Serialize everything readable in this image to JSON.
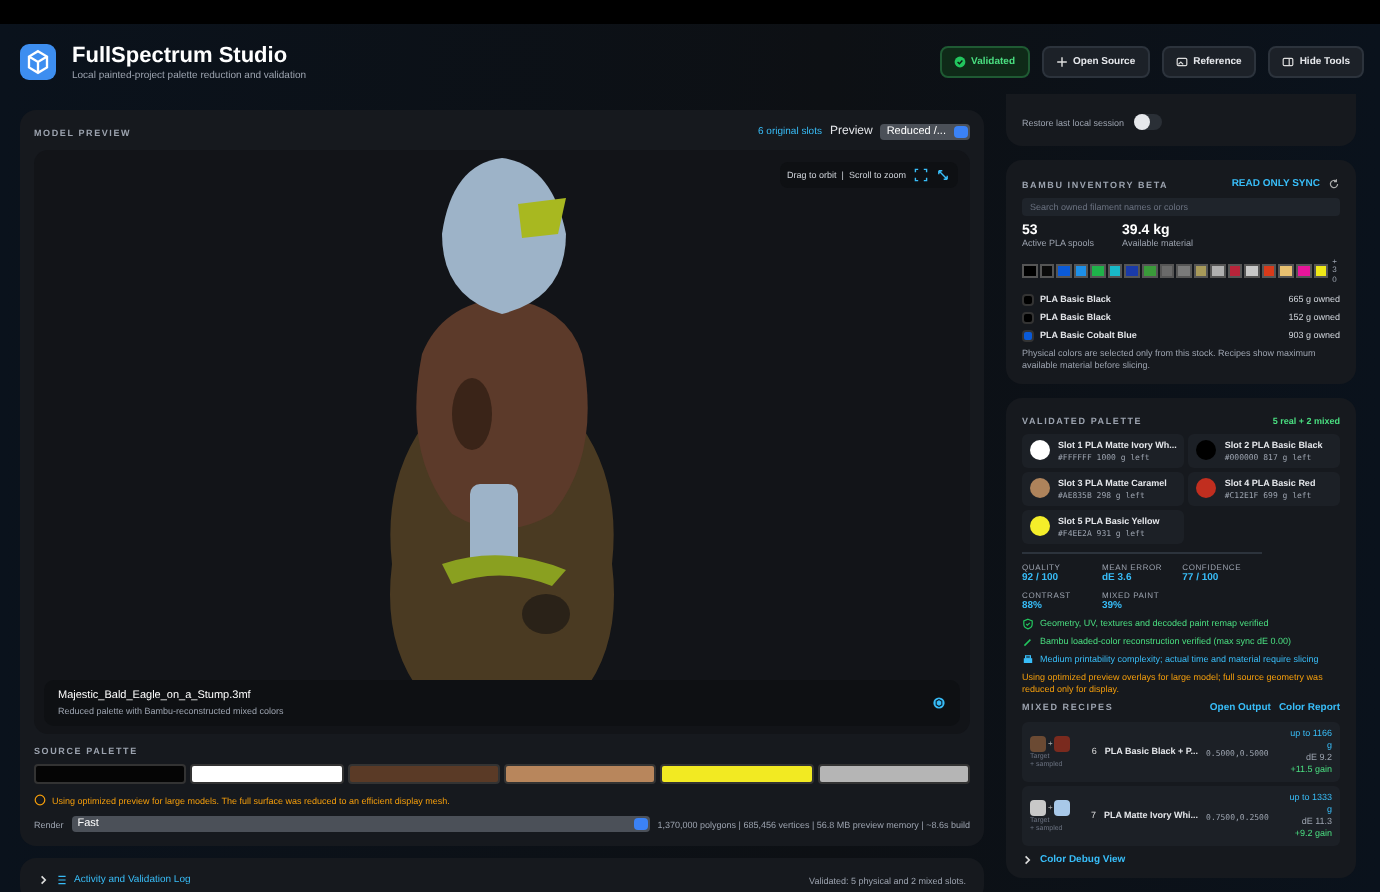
{
  "app": {
    "title": "FullSpectrum Studio",
    "subtitle": "Local painted-project palette reduction and validation"
  },
  "header_actions": [
    {
      "kind": "status",
      "label": "Validated"
    },
    {
      "kind": "open",
      "label": "Open Source"
    },
    {
      "kind": "reference",
      "label": "Reference"
    },
    {
      "kind": "hide",
      "label": "Hide Tools"
    }
  ],
  "model_preview": {
    "label": "MODEL PREVIEW",
    "slots_link": "6 original slots",
    "preview_label": "Preview",
    "preview_value": "Reduced /...",
    "hint": "Drag to orbit  |  Scroll to zoom",
    "file_name": "Majestic_Bald_Eagle_on_a_Stump.3mf",
    "file_note": "Reduced palette with Bambu-reconstructed mixed colors"
  },
  "source_palette": {
    "label": "SOURCE PALETTE",
    "swatches": [
      {
        "color": "#050505"
      },
      {
        "color": "#ffffff"
      },
      {
        "color": "#5a3a26"
      },
      {
        "color": "#b8865c"
      },
      {
        "color": "#f2ea22"
      },
      {
        "color": "#b5b5b5"
      }
    ],
    "warning": "Using optimized preview for large models. The full surface was reduced to an efficient display mesh.",
    "render_label": "Render",
    "render_value": "Fast",
    "stats": "1,370,000 polygons | 685,456 vertices | 56.8 MB preview memory | ~8.6s build"
  },
  "log": {
    "title": "Activity and Validation Log",
    "expanded": false,
    "status": "Validated: 5 physical and 2 mixed slots."
  },
  "session": {
    "label": "Restore last local session",
    "on": false
  },
  "inventory": {
    "title": "BAMBU INVENTORY BETA",
    "sync": "READ ONLY SYNC",
    "search_placeholder": "Search owned filament names or colors",
    "stats": [
      {
        "value": "53",
        "label": "Active PLA spools"
      },
      {
        "value": "39.4 kg",
        "label": "Available material"
      }
    ],
    "colors": [
      {
        "color": "#000000"
      },
      {
        "color": "#0a0a0a"
      },
      {
        "color": "#0a5ad8"
      },
      {
        "color": "#1e90e8"
      },
      {
        "color": "#1fb24a"
      },
      {
        "color": "#18b8c8"
      },
      {
        "color": "#1a3aa8"
      },
      {
        "color": "#3a9a3a"
      },
      {
        "color": "#6a6a6a"
      },
      {
        "color": "#7a7a7a"
      },
      {
        "color": "#a89a5a"
      },
      {
        "color": "#b0b0b0"
      },
      {
        "color": "#b8243a"
      },
      {
        "color": "#c8c8c8"
      },
      {
        "color": "#d83a1a"
      },
      {
        "color": "#e8c070"
      },
      {
        "color": "#e8159a"
      },
      {
        "color": "#f0e818"
      }
    ],
    "more": "+30",
    "spools": [
      {
        "name": "PLA Basic Black",
        "owned": "665 g owned",
        "color": "#000000"
      },
      {
        "name": "PLA Basic Black",
        "owned": "152 g owned",
        "color": "#000000"
      },
      {
        "name": "PLA Basic Cobalt Blue",
        "owned": "903 g owned",
        "color": "#0a5ad8"
      }
    ],
    "note": "Physical colors are selected only from this stock. Recipes show maximum available material before slicing."
  },
  "palette": {
    "title": "VALIDATED PALETTE",
    "summary": "5 real + 2 mixed",
    "slots": [
      {
        "name": "Slot 1  PLA Matte Ivory Wh...",
        "hex": "#FFFFFF",
        "left": "1000 g left",
        "color": "#ffffff"
      },
      {
        "name": "Slot 2  PLA Basic Black",
        "hex": "#000000",
        "left": "817 g left",
        "color": "#000000"
      },
      {
        "name": "Slot 3  PLA Matte Caramel",
        "hex": "#AE835B",
        "left": "298 g left",
        "color": "#ae835b"
      },
      {
        "name": "Slot 4  PLA Basic Red",
        "hex": "#C12E1F",
        "left": "699 g left",
        "color": "#c12e1f"
      },
      {
        "name": "Slot 5  PLA Basic Yellow",
        "hex": "#F4EE2A",
        "left": "931 g left",
        "color": "#f4ee2a"
      }
    ],
    "metrics": [
      {
        "label": "QUALITY",
        "value": "92 / 100"
      },
      {
        "label": "MEAN ERROR",
        "value": "dE 3.6"
      },
      {
        "label": "CONFIDENCE",
        "value": "77 / 100"
      },
      {
        "label": "CONTRAST",
        "value": "88%"
      },
      {
        "label": "MIXED PAINT",
        "value": "39%"
      }
    ],
    "checks": [
      {
        "kind": "verified",
        "text": "Geometry, UV, textures and decoded paint remap verified"
      },
      {
        "kind": "reconstruct",
        "text": "Bambu loaded-color reconstruction verified (max sync dE 0.00)"
      },
      {
        "kind": "printability",
        "text": "Medium printability complexity; actual time and material require slicing"
      }
    ],
    "warning": "Using optimized preview overlays for large model; full source geometry was reduced only for display.",
    "mixed": {
      "title": "MIXED RECIPES",
      "links": [
        "Open Output",
        "Color Report"
      ],
      "recipes": [
        {
          "colors": [
            {
              "color": "#6b4a33"
            },
            {
              "color": "#7a2a1e"
            }
          ],
          "joiner": "+",
          "target": "Target",
          "sub": "+ sampled",
          "index": "6",
          "name": "PLA Basic Black + P...",
          "ratio": "0.5000,0.5000",
          "amount": "up to 1166 g",
          "de": "dE 9.2",
          "gain": "+11.5 gain"
        },
        {
          "colors": [
            {
              "color": "#c8c8c8"
            },
            {
              "color": "#a8c8e8"
            }
          ],
          "joiner": "+",
          "target": "Target",
          "sub": "+ sampled",
          "index": "7",
          "name": "PLA Matte Ivory Whi...",
          "ratio": "0.7500,0.2500",
          "amount": "up to 1333 g",
          "de": "dE 11.3",
          "gain": "+9.2 gain"
        }
      ]
    },
    "debug": {
      "label": "Color Debug View",
      "expanded": false
    }
  }
}
